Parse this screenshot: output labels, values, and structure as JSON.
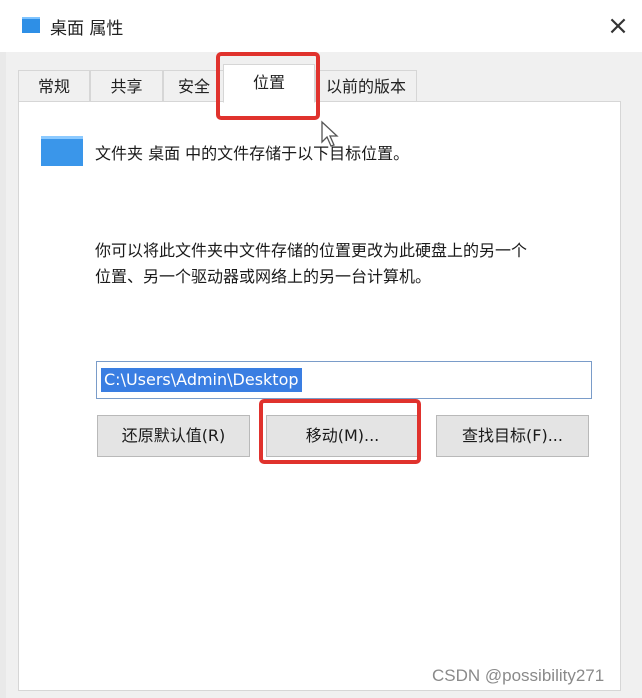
{
  "window": {
    "title": "桌面 属性",
    "close_glyph": "×"
  },
  "tabs": [
    {
      "label": "常规",
      "active": false
    },
    {
      "label": "共享",
      "active": false
    },
    {
      "label": "安全",
      "active": false
    },
    {
      "label": "位置",
      "active": true
    },
    {
      "label": "以前的版本",
      "active": false
    }
  ],
  "location": {
    "heading": "文件夹 桌面 中的文件存储于以下目标位置。",
    "description_line1": "你可以将此文件夹中文件存储的位置更改为此硬盘上的另一个",
    "description_line2": "位置、另一个驱动器或网络上的另一台计算机。",
    "path_value": "C:\\Users\\Admin\\Desktop",
    "buttons": {
      "restore": "还原默认值(R)",
      "move": "移动(M)...",
      "find_target": "查找目标(F)..."
    }
  },
  "watermark": "CSDN @possibility271",
  "colors": {
    "highlight": "#e0322d",
    "selection": "#3a7ee2",
    "folder": "#3a96ea"
  }
}
